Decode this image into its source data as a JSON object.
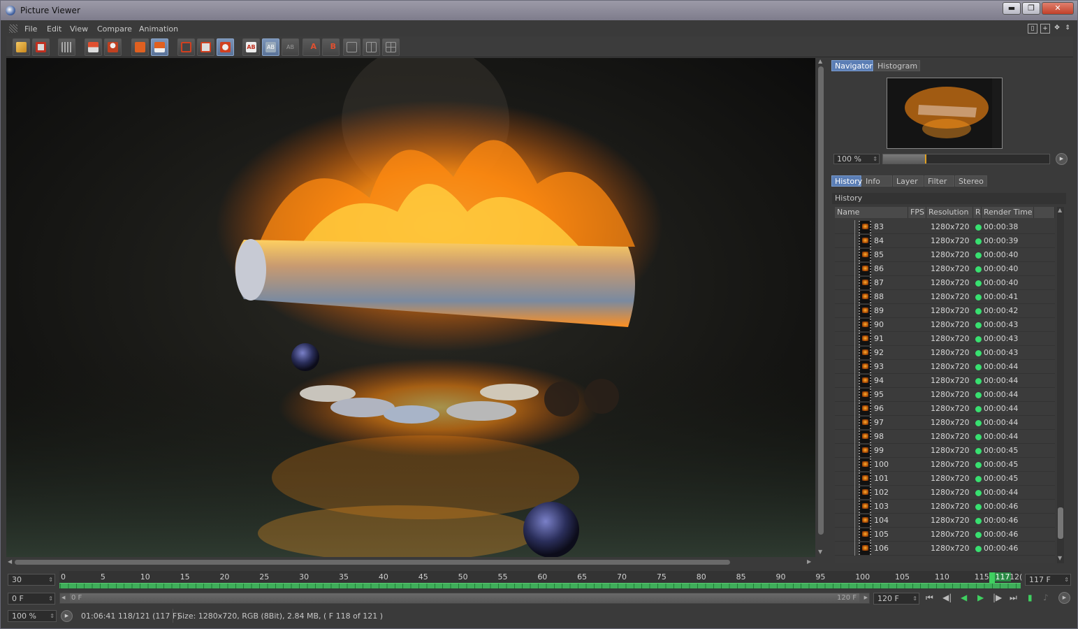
{
  "window": {
    "title": "Picture Viewer",
    "controls": {
      "minimize": "▬",
      "maximize": "❐",
      "close": "✕"
    }
  },
  "menu": [
    "File",
    "Edit",
    "View",
    "Compare",
    "Animation"
  ],
  "toolbar": {
    "buttons": [
      "open",
      "save",
      "grid-view",
      "layers",
      "user",
      "clip-a",
      "clip-b",
      "region",
      "camera",
      "ab-compare",
      "ab-split",
      "ab-overlay",
      "set-a",
      "set-b",
      "layout-1",
      "layout-2",
      "layout-3"
    ],
    "labels": {
      "set_a": "A",
      "set_b": "B",
      "ab": "AB"
    }
  },
  "navigator": {
    "tabs": [
      "Navigator",
      "Histogram"
    ],
    "zoom": "100 %",
    "zoom_fraction": 0.25
  },
  "history": {
    "tabs": [
      "History",
      "Info",
      "Layer",
      "Filter",
      "Stereo"
    ],
    "title": "History",
    "columns": [
      "Name",
      "FPS",
      "Resolution",
      "R",
      "Render Time"
    ],
    "rows": [
      {
        "name": "83",
        "res": "1280x720",
        "time": "00:00:38"
      },
      {
        "name": "84",
        "res": "1280x720",
        "time": "00:00:39"
      },
      {
        "name": "85",
        "res": "1280x720",
        "time": "00:00:40"
      },
      {
        "name": "86",
        "res": "1280x720",
        "time": "00:00:40"
      },
      {
        "name": "87",
        "res": "1280x720",
        "time": "00:00:40"
      },
      {
        "name": "88",
        "res": "1280x720",
        "time": "00:00:41"
      },
      {
        "name": "89",
        "res": "1280x720",
        "time": "00:00:42"
      },
      {
        "name": "90",
        "res": "1280x720",
        "time": "00:00:43"
      },
      {
        "name": "91",
        "res": "1280x720",
        "time": "00:00:43"
      },
      {
        "name": "92",
        "res": "1280x720",
        "time": "00:00:43"
      },
      {
        "name": "93",
        "res": "1280x720",
        "time": "00:00:44"
      },
      {
        "name": "94",
        "res": "1280x720",
        "time": "00:00:44"
      },
      {
        "name": "95",
        "res": "1280x720",
        "time": "00:00:44"
      },
      {
        "name": "96",
        "res": "1280x720",
        "time": "00:00:44"
      },
      {
        "name": "97",
        "res": "1280x720",
        "time": "00:00:44"
      },
      {
        "name": "98",
        "res": "1280x720",
        "time": "00:00:44"
      },
      {
        "name": "99",
        "res": "1280x720",
        "time": "00:00:45"
      },
      {
        "name": "100",
        "res": "1280x720",
        "time": "00:00:45"
      },
      {
        "name": "101",
        "res": "1280x720",
        "time": "00:00:45"
      },
      {
        "name": "102",
        "res": "1280x720",
        "time": "00:00:44"
      },
      {
        "name": "103",
        "res": "1280x720",
        "time": "00:00:46"
      },
      {
        "name": "104",
        "res": "1280x720",
        "time": "00:00:46"
      },
      {
        "name": "105",
        "res": "1280x720",
        "time": "00:00:46"
      },
      {
        "name": "106",
        "res": "1280x720",
        "time": "00:00:46"
      }
    ]
  },
  "timeline": {
    "fps": "30",
    "start": "0 F",
    "range_start": "0 F",
    "range_end": "120 F",
    "end": "120 F",
    "current": "117 F",
    "current_mark": "117",
    "end_mark": "12(",
    "ticks": [
      "0",
      "5",
      "10",
      "15",
      "20",
      "25",
      "30",
      "35",
      "40",
      "45",
      "50",
      "55",
      "60",
      "65",
      "70",
      "75",
      "80",
      "85",
      "90",
      "95",
      "100",
      "105",
      "110",
      "115"
    ],
    "max_frame": 121,
    "current_frame": 117
  },
  "status": {
    "zoom": "100 %",
    "timecode": "01:06:41 118/121 (117 F)",
    "info": "Size: 1280x720, RGB (8Bit), 2.84 MB,  ( F 118 of 121 )"
  },
  "colors": {
    "accent": "#5b7eb5",
    "progress": "#38e070",
    "timeline": "#3fae5a"
  }
}
